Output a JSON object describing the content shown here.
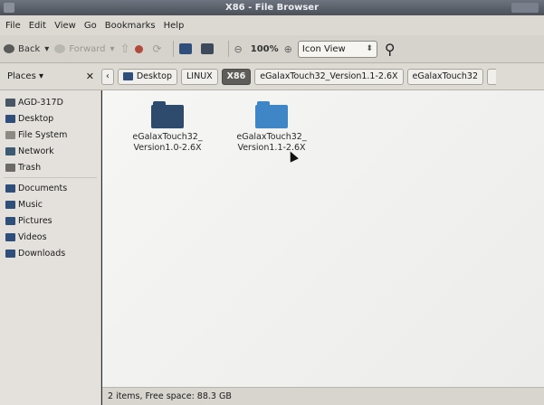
{
  "window": {
    "title": "X86 - File Browser"
  },
  "menubar": [
    "File",
    "Edit",
    "View",
    "Go",
    "Bookmarks",
    "Help"
  ],
  "toolbar": {
    "back_label": "Back",
    "forward_label": "Forward",
    "zoom": "100%",
    "view_mode": "Icon View"
  },
  "places_header": {
    "label": "Places",
    "close": "✕"
  },
  "breadcrumbs": [
    {
      "label": "Desktop"
    },
    {
      "label": "LINUX"
    },
    {
      "label": "X86"
    },
    {
      "label": "eGalaxTouch32_Version1.1-2.6X"
    },
    {
      "label": "eGalaxTouch32"
    }
  ],
  "sidebar": {
    "items": [
      {
        "label": "AGD-317D",
        "icon": "computer-icon"
      },
      {
        "label": "Desktop",
        "icon": "desktop-icon"
      },
      {
        "label": "File System",
        "icon": "drive-icon"
      },
      {
        "label": "Network",
        "icon": "network-icon"
      },
      {
        "label": "Trash",
        "icon": "trash-icon"
      }
    ],
    "bookmarks": [
      {
        "label": "Documents",
        "icon": "folder-icon"
      },
      {
        "label": "Music",
        "icon": "folder-icon"
      },
      {
        "label": "Pictures",
        "icon": "folder-icon"
      },
      {
        "label": "Videos",
        "icon": "folder-icon"
      },
      {
        "label": "Downloads",
        "icon": "folder-icon"
      }
    ]
  },
  "files": [
    {
      "line1": "eGalaxTouch32_",
      "line2": "Version1.0-2.6X",
      "color": "#2e4b6e"
    },
    {
      "line1": "eGalaxTouch32_",
      "line2": "Version1.1-2.6X",
      "color": "#3f86c6"
    }
  ],
  "status": {
    "text": "2 items, Free space: 88.3 GB"
  },
  "colors": {
    "folder_dark": "#2e4b6e",
    "folder_selected": "#3f86c6",
    "active_crumb": "#5e5d59"
  }
}
